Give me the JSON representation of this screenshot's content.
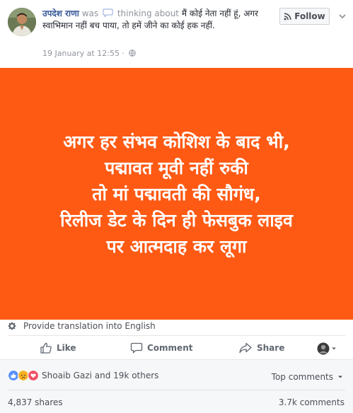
{
  "post": {
    "author": "उपदेश राणा",
    "was": "was",
    "activity": "thinking about",
    "text": "मैं कोई नेता नहीं हूं, अगर स्वाभिमान नहीं बच पाया, तो हमें जीने का कोई हक नहीं.",
    "timestamp": "19 January at 12:55",
    "separator": "·",
    "follow_label": "Follow"
  },
  "image": {
    "line1": "अगर हर संभव कोशिश के बाद भी,",
    "line2": "पद्मावत मूवी नहीं रुकी",
    "line3": "तो मां पद्मावती की सौगंध,",
    "line4": "रिलीज डेट के दिन ही फेसबुक लाइव",
    "line5": "पर आत्मदाह कर लूगा",
    "background": "#fe5a14"
  },
  "translate_label": "Provide translation into English",
  "actions": {
    "like": "Like",
    "comment": "Comment",
    "share": "Share"
  },
  "footer": {
    "reactors": "Shoaib Gazi and 19k others",
    "top_comments": "Top comments",
    "shares": "4,837 shares",
    "comments": "3.7k comments"
  },
  "colors": {
    "link": "#365899",
    "muted": "#90949c",
    "like_blue": "#5890ff",
    "love_red": "#f25268",
    "haha_yellow": "#f7b125"
  },
  "icons": [
    "speech-bubble-icon",
    "globe-icon",
    "rss-icon",
    "chevron-down-icon",
    "gear-icon",
    "like-icon",
    "comment-icon",
    "share-icon",
    "like-reaction-icon",
    "sad-reaction-icon",
    "love-reaction-icon"
  ]
}
